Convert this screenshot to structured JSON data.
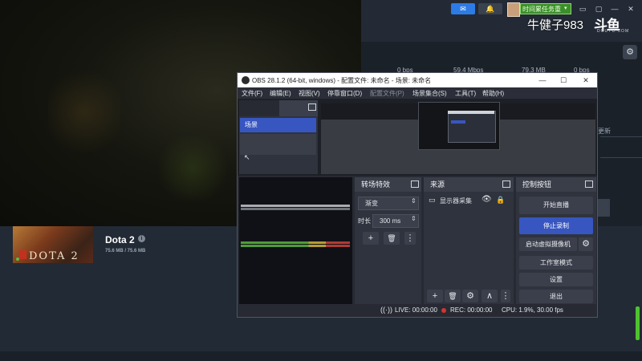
{
  "topbar": {
    "broadcast_icon": "megaphone-icon",
    "bell_icon": "bell-icon",
    "task_label": "时间累任务重",
    "caret": "▾",
    "minimize": "▭",
    "restore": "▢",
    "close": "✕"
  },
  "streamer": {
    "name": "牛健子983",
    "logo": "斗鱼",
    "logo_sub": "DOUYU.COM"
  },
  "stream_stats": [
    "0 bps",
    "59.4 Mbps",
    "79.3 MB",
    "0 bps"
  ],
  "side": {
    "update_text": "更新"
  },
  "library": {
    "game_title": "Dota 2",
    "thumb_title": "DOTA 2",
    "size": "75.6 MB / 75.6 MB",
    "info_icon": "i"
  },
  "obs": {
    "title": "OBS 28.1.2 (64-bit, windows) - 配置文件: 未命名 - 场景: 未命名",
    "window": {
      "minimize": "—",
      "maximize": "☐",
      "close": "✕"
    },
    "menu": [
      {
        "label": "文件(F)",
        "enabled": true
      },
      {
        "label": "编辑(E)",
        "enabled": true
      },
      {
        "label": "视图(V)",
        "enabled": true
      },
      {
        "label": "停靠窗口(D)",
        "enabled": true
      },
      {
        "label": "配置文件(P)",
        "enabled": false
      },
      {
        "label": "场景集合(S)",
        "enabled": true
      },
      {
        "label": "工具(T)",
        "enabled": true
      },
      {
        "label": "帮助(H)",
        "enabled": true
      }
    ],
    "scene": "场景",
    "transitions": {
      "title": "转场特效",
      "selected": "渐变",
      "duration_label": "时长",
      "duration_value": "300 ms",
      "add": "+",
      "remove": "🗑",
      "more": "⋮"
    },
    "sources": {
      "title": "来源",
      "items": [
        {
          "label": "显示器采集",
          "visible_icon": "eye-icon",
          "lock_icon": "lock-icon"
        }
      ],
      "buttons": {
        "add": "+",
        "remove": "🗑",
        "settings": "⚙",
        "up": "∧",
        "more": "⋮"
      }
    },
    "controls": {
      "title": "控制按钮",
      "start_stream": "开始直播",
      "stop_record": "停止录制",
      "virtual_cam": "启动虚拟摄像机",
      "studio_mode": "工作室模式",
      "settings": "设置",
      "exit": "退出",
      "accent": "#3856c0"
    },
    "status": {
      "live": "LIVE: 00:00:00",
      "rec": "REC: 00:00:00",
      "cpu": "CPU: 1.9%, 30.00 fps"
    }
  }
}
